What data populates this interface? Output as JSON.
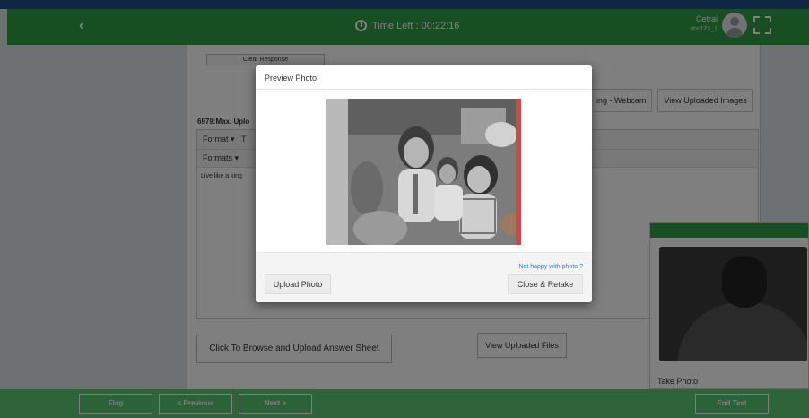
{
  "header": {
    "back_icon": "chevron-left",
    "timer_label": "Time Left : 00:22:16",
    "user_name": "Cetrai",
    "user_id": "abc123_1"
  },
  "main": {
    "clear_response": "Clear Response",
    "question_label": "6979:Max. Uplo",
    "toolbar_format": "Format ▾",
    "toolbar_t": "T",
    "toolbar_formats": "Formats ▾",
    "editor_text": "Live like a king",
    "webcam_label": "ing - Webcam",
    "view_uploaded_images": "View Uploaded Images",
    "browse_button": "Click To Browse and Upload Answer Sheet",
    "view_uploaded_files": "View Uploaded Files"
  },
  "webcam": {
    "take_photo": "Take Photo"
  },
  "footer": {
    "flag": "Flag",
    "previous": "< Previous",
    "next": "Next >",
    "end_test": "End Test"
  },
  "modal": {
    "title": "Preview Photo",
    "not_happy": "Not happy with photo ?",
    "upload_photo": "Upload Photo",
    "close_retake": "Close & Retake"
  },
  "colors": {
    "header_green": "#2f9e44",
    "footer_green": "#5ec977",
    "link_blue": "#2a7bd1"
  }
}
